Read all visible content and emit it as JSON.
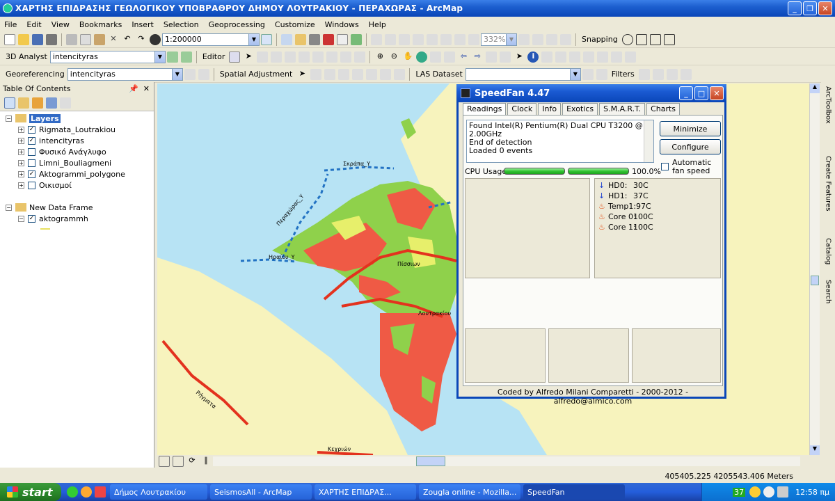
{
  "window": {
    "title": "ΧΑΡΤΗΣ ΕΠΙΔΡΑΣΗΣ ΓΕΩΛΟΓΙΚΟΥ ΥΠΟΒΡΑΘΡΟΥ  ΔΗΜΟΥ ΛΟΥΤΡΑΚΙΟΥ  -  ΠΕΡΑΧΩΡΑΣ - ArcMap"
  },
  "menu": [
    "File",
    "Edit",
    "View",
    "Bookmarks",
    "Insert",
    "Selection",
    "Geoprocessing",
    "Customize",
    "Windows",
    "Help"
  ],
  "toolbar1": {
    "scale": "1:200000",
    "zoom": "332%",
    "snapping": "Snapping"
  },
  "toolbar2": {
    "analyst": "3D Analyst",
    "layer": "intencityras",
    "editor": "Editor"
  },
  "toolbar3": {
    "georef": "Georeferencing",
    "layer": "intencityras",
    "spatial": "Spatial Adjustment",
    "las": "LAS Dataset",
    "filters": "Filters"
  },
  "toc": {
    "title": "Table Of Contents",
    "layers_label": "Layers",
    "layers": [
      {
        "name": "Rigmata_Loutrakiou",
        "checked": true
      },
      {
        "name": "intencityras",
        "checked": true
      },
      {
        "name": "Φυσικό Ανάγλυφο",
        "checked": false
      },
      {
        "name": "Limni_Bouliagmeni",
        "checked": false
      },
      {
        "name": "Aktogrammi_polygone",
        "checked": true
      },
      {
        "name": "Οικισμοί",
        "checked": false
      }
    ],
    "frame_label": "New Data Frame",
    "frame_layers": [
      {
        "name": "aktogrammh",
        "checked": true
      }
    ]
  },
  "map_labels": [
    "Σκράπα_Υ",
    "Περαχώρας_Υ",
    "Ηραίου_Υ",
    "Πίσσιων",
    "Λουτρακίου",
    "Ρήγματα",
    "Κεχριών"
  ],
  "dock": [
    "ArcToolbox",
    "Create Features",
    "Catalog",
    "Search"
  ],
  "status": {
    "coords": "405405.225  4205543.406 Meters"
  },
  "speedfan": {
    "title": "SpeedFan 4.47",
    "tabs": [
      "Readings",
      "Clock",
      "Info",
      "Exotics",
      "S.M.A.R.T.",
      "Charts"
    ],
    "log": [
      "Found Intel(R) Pentium(R) Dual CPU T3200 @ 2.00GHz",
      "End of detection",
      "Loaded 0 events"
    ],
    "minimize": "Minimize",
    "configure": "Configure",
    "cpu_label": "CPU Usage",
    "cpu_value": "100.0%",
    "cpu_bars": [
      1.0,
      1.0
    ],
    "auto_fan": "Automatic fan speed",
    "temps": [
      {
        "label": "HD0:",
        "value": "30C",
        "icon": "arrow-down-icon"
      },
      {
        "label": "HD1:",
        "value": "37C",
        "icon": "arrow-down-icon"
      },
      {
        "label": "Temp1:",
        "value": "97C",
        "icon": "flame-icon"
      },
      {
        "label": "Core 0:",
        "value": "100C",
        "icon": "flame-icon"
      },
      {
        "label": "Core 1:",
        "value": "100C",
        "icon": "flame-icon"
      }
    ],
    "footer": "Coded by Alfredo Milani Comparetti - 2000-2012 - alfredo@almico.com"
  },
  "taskbar": {
    "start": "start",
    "tasks": [
      "Δήμος Λουτρακίου",
      "SeismosAll - ArcMap",
      "ΧΑΡΤΗΣ ΕΠΙΔΡΑΣ...",
      "Zougla online - Mozilla...",
      "SpeedFan"
    ],
    "tray_num": "37",
    "time": "12:58 πμ"
  }
}
